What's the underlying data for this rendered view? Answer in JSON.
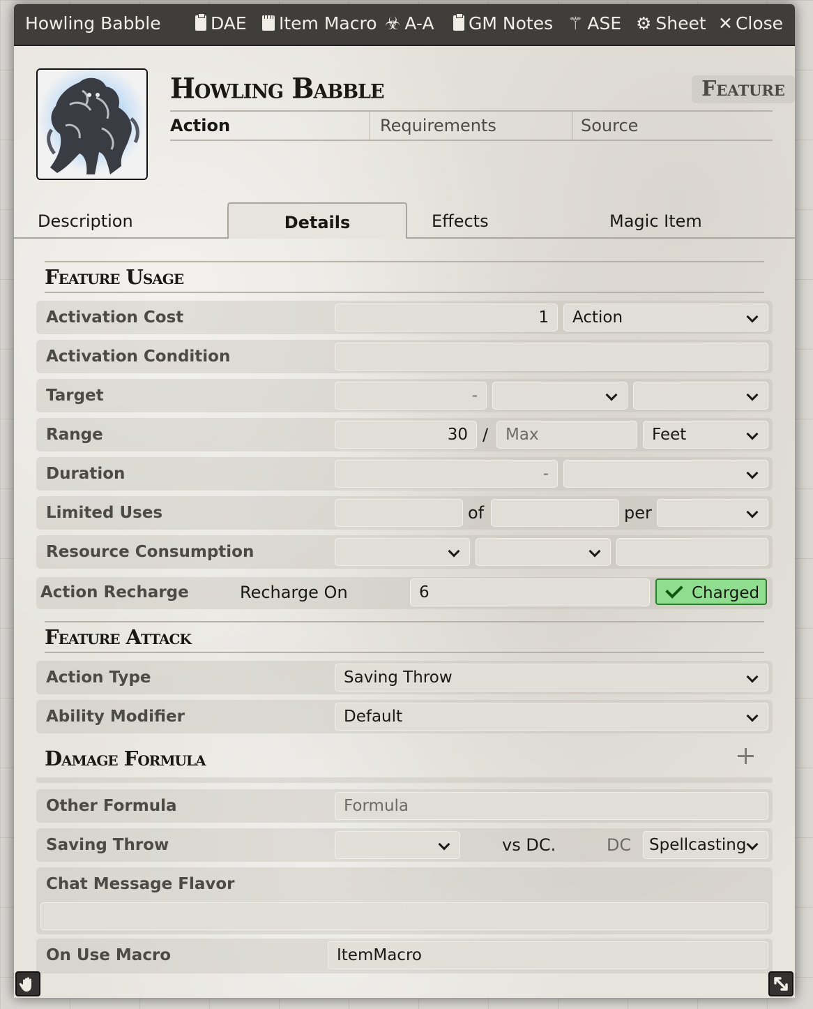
{
  "window": {
    "title": "Howling Babble",
    "header_buttons": [
      {
        "label": "DAE",
        "icon": "clipboard-icon"
      },
      {
        "label": "Item Macro",
        "icon": "sticky-note-icon"
      },
      {
        "label": "A-A",
        "icon": "biohazard-icon"
      },
      {
        "label": "GM Notes",
        "icon": "clipboard-icon"
      },
      {
        "label": "ASE",
        "icon": "magic-wand-icon"
      },
      {
        "label": "Sheet",
        "icon": "gear-icon"
      },
      {
        "label": "Close",
        "icon": "close-icon"
      }
    ]
  },
  "item": {
    "name": "Howling Babble",
    "type": "Feature",
    "activation": "Action",
    "requirements_placeholder": "Requirements",
    "source_placeholder": "Source"
  },
  "tabs": [
    "Description",
    "Details",
    "Effects",
    "Magic Item"
  ],
  "active_tab": "Details",
  "usage": {
    "title": "Feature Usage",
    "activation_cost": {
      "label": "Activation Cost",
      "value": "1",
      "type": "Action"
    },
    "activation_condition": {
      "label": "Activation Condition",
      "value": ""
    },
    "target": {
      "label": "Target",
      "value": "-",
      "unit": "",
      "type": ""
    },
    "range": {
      "label": "Range",
      "value": "30",
      "sep": "/",
      "long_placeholder": "Max",
      "units": "Feet"
    },
    "duration": {
      "label": "Duration",
      "value": "-",
      "units": ""
    },
    "limited_uses": {
      "label": "Limited Uses",
      "value": "",
      "of": "of",
      "max": "",
      "per": "per",
      "period": ""
    },
    "resource": {
      "label": "Resource Consumption",
      "type": "",
      "target": "",
      "amount": ""
    },
    "recharge": {
      "label": "Action Recharge",
      "on_label": "Recharge On",
      "value": "6",
      "charged": "Charged"
    }
  },
  "attack": {
    "title": "Feature Attack",
    "action_type": {
      "label": "Action Type",
      "value": "Saving Throw"
    },
    "ability": {
      "label": "Ability Modifier",
      "value": "Default"
    }
  },
  "damage": {
    "title": "Damage Formula",
    "other": {
      "label": "Other Formula",
      "placeholder": "Formula"
    },
    "save": {
      "label": "Saving Throw",
      "ability": "",
      "vs": "vs DC.",
      "dc_label": "DC",
      "scaling": "Spellcasting"
    },
    "chat_flavor": {
      "label": "Chat Message Flavor",
      "value": ""
    },
    "on_use": {
      "label": "On Use Macro",
      "value": "ItemMacro"
    }
  }
}
